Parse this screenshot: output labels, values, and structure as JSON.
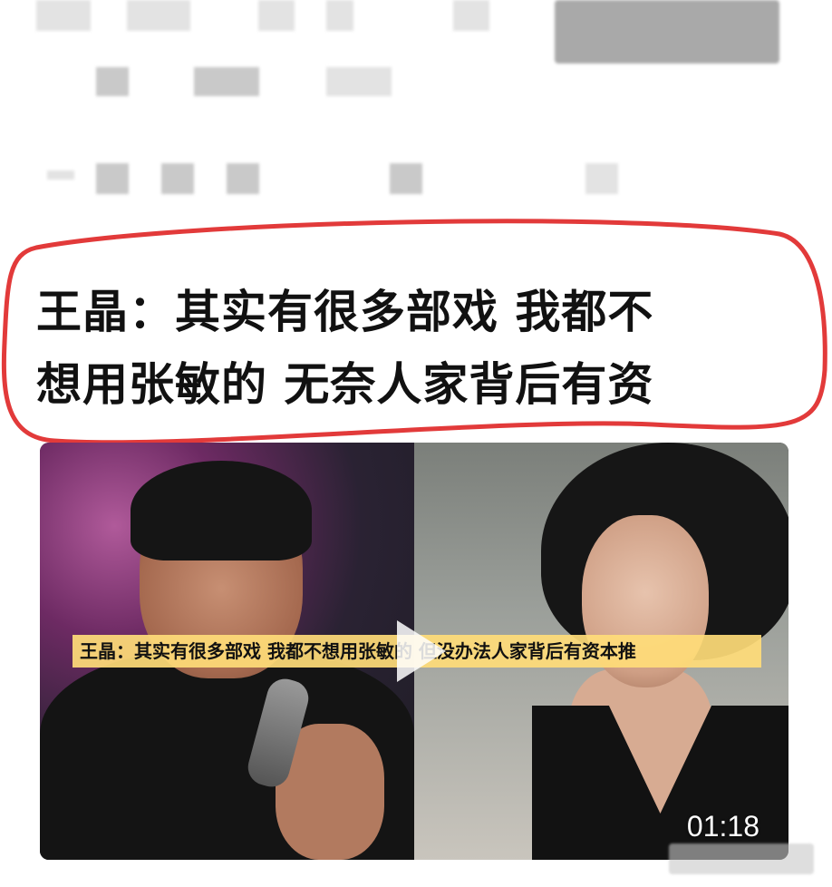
{
  "post": {
    "headline_line1": "王晶：其实有很多部戏 我都不",
    "headline_line2": "想用张敏的 无奈人家背后有资"
  },
  "video": {
    "caption": "王晶：其实有很多部戏 我都不想用张敏的 但没办法人家背后有资本推",
    "duration": "01:18",
    "play_icon": "play-icon"
  },
  "colors": {
    "outline": "#e23a3a",
    "caption_bg": "#ffdc78"
  }
}
